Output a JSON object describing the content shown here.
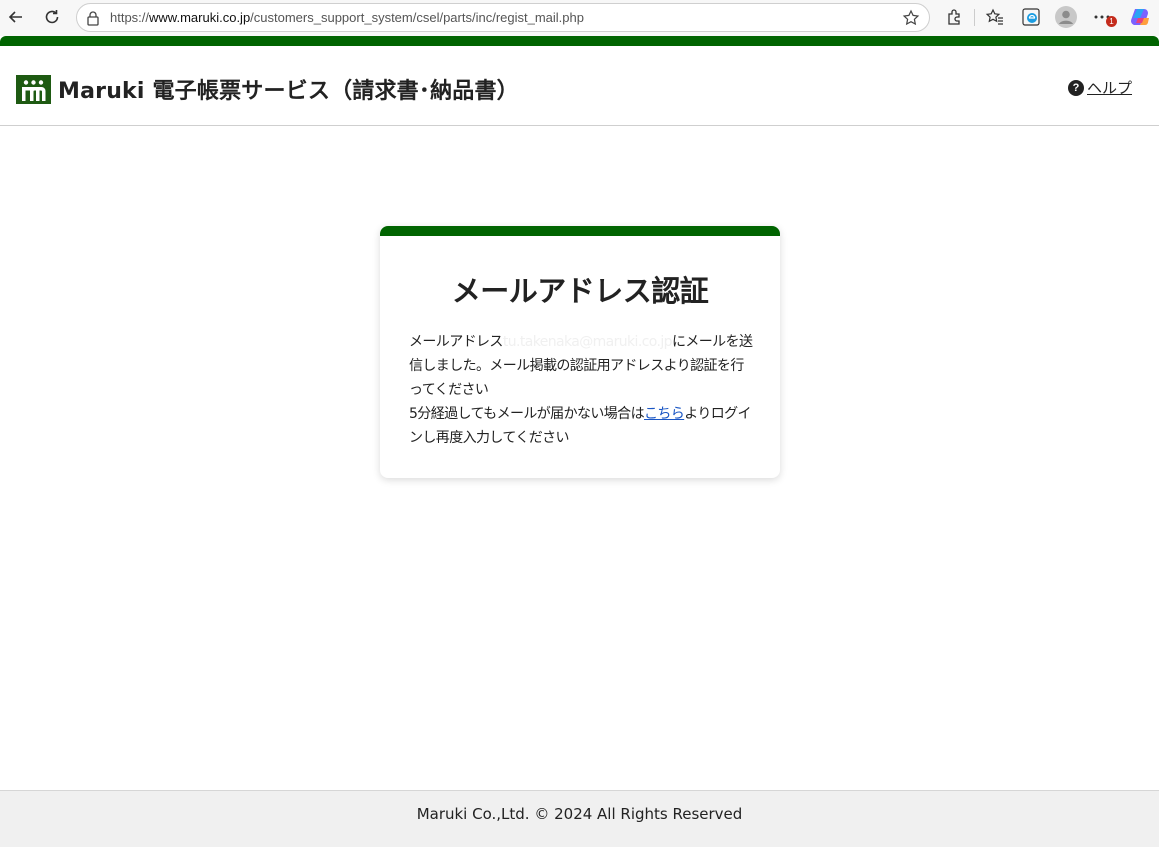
{
  "browser": {
    "url_scheme": "https://",
    "url_host": "www.maruki.co.jp",
    "url_path": "/customers_support_system/csel/parts/inc/regist_mail.php",
    "notification_count": "1",
    "icons": [
      "back-icon",
      "reload-icon",
      "lock-icon",
      "star-icon",
      "extensions-icon",
      "favorites-icon",
      "edge-icon",
      "profile-icon",
      "more-icon",
      "copilot-icon"
    ]
  },
  "header": {
    "logo_text": "m",
    "title": "Maruki 電子帳票サービス（請求書･納品書）",
    "help_icon": "?",
    "help_label": "ヘルプ"
  },
  "card": {
    "title": "メールアドレス認証",
    "line_prefix": "メールアドレス",
    "email": "tu.takenaka@maruki.co.jp",
    "line_suffix": "にメールを送信しました。メール掲載の認証用アドレスより認証を行ってください",
    "retry_prefix": "5分経過してもメールが届かない場合は",
    "retry_link": "こちら",
    "retry_suffix": "よりログインし再度入力してください"
  },
  "footer": {
    "copyright": "Maruki Co.,Ltd. © 2024 All Rights Reserved"
  },
  "colors": {
    "brand_green": "#006400",
    "logo_green": "#1e5a12",
    "link_blue": "#1a56c4"
  }
}
